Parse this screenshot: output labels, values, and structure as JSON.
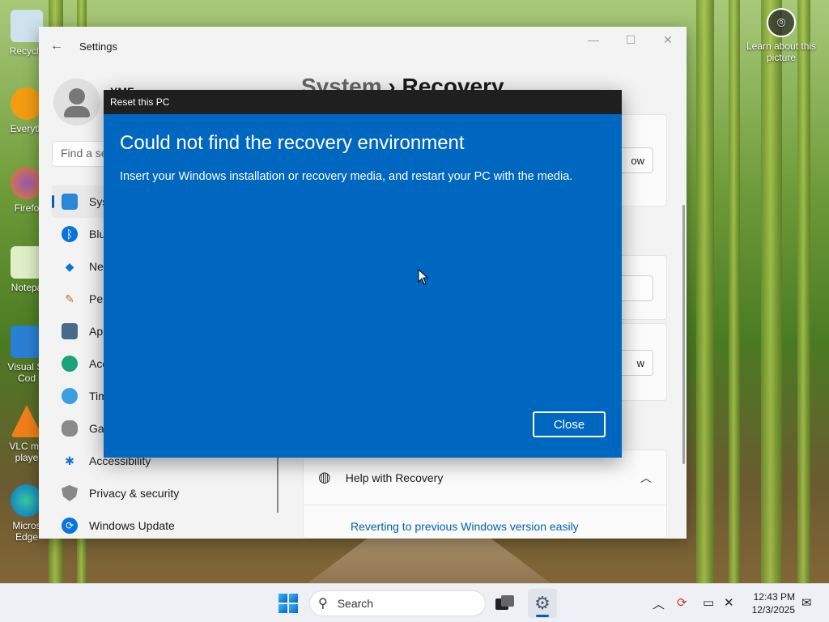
{
  "desktop": {
    "icons": [
      {
        "label": "Recycle",
        "icon": "recycle-bin-icon"
      },
      {
        "label": "Everyth",
        "icon": "everything-icon"
      },
      {
        "label": "Firefo",
        "icon": "firefox-icon"
      },
      {
        "label": "Notepa",
        "icon": "notepad-icon"
      },
      {
        "label": "Visual St Cod",
        "icon": "vscode-icon"
      },
      {
        "label": "VLC me playe",
        "icon": "vlc-icon"
      },
      {
        "label": "Micros Edge",
        "icon": "edge-icon"
      }
    ],
    "learn_label": "Learn about this picture"
  },
  "settings": {
    "title": "Settings",
    "user_name": "YMF",
    "search_placeholder": "Find a se",
    "heading_parent": "System",
    "heading_sep": "›",
    "heading_current": "Recovery",
    "nav": [
      {
        "label": "Sys",
        "icon": "system-icon",
        "selected": true
      },
      {
        "label": "Blu",
        "icon": "bluetooth-icon"
      },
      {
        "label": "Net",
        "icon": "network-icon"
      },
      {
        "label": "Per",
        "icon": "personalization-icon"
      },
      {
        "label": "App",
        "icon": "apps-icon"
      },
      {
        "label": "Acc",
        "icon": "accounts-icon"
      },
      {
        "label": "Tim",
        "icon": "time-icon"
      },
      {
        "label": "Gar",
        "icon": "gaming-icon"
      },
      {
        "label": "Accessibility",
        "icon": "accessibility-icon"
      },
      {
        "label": "Privacy & security",
        "icon": "shield-icon"
      },
      {
        "label": "Windows Update",
        "icon": "update-icon"
      }
    ],
    "card_buttons": [
      "ow",
      "w"
    ],
    "help_title": "Help with Recovery",
    "help_link": "Reverting to previous Windows version easily"
  },
  "dialog": {
    "title": "Reset this PC",
    "heading": "Could not find the recovery environment",
    "message": "Insert your Windows installation or recovery media, and restart your PC with the media.",
    "close_label": "Close"
  },
  "taskbar": {
    "search_label": "Search",
    "time": "12:43 PM",
    "date": "12/3/2025"
  }
}
